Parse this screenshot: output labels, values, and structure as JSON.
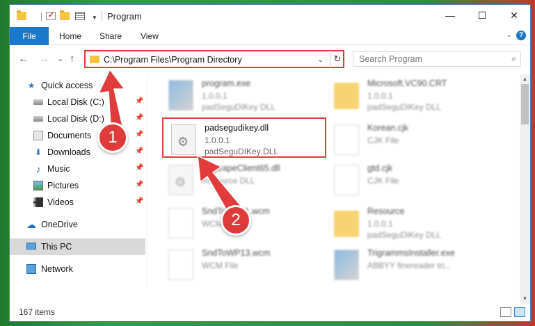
{
  "title_bar": {
    "title": "Program",
    "minimize_glyph": "—",
    "maximize_glyph": "☐",
    "close_glyph": "✕"
  },
  "ribbon": {
    "tabs": [
      "File",
      "Home",
      "Share",
      "View"
    ],
    "expand_glyph": "⌄",
    "help_glyph": "?"
  },
  "navigation": {
    "back_glyph": "←",
    "forward_glyph": "→",
    "recent_glyph": "⌄",
    "up_glyph": "↑"
  },
  "address_bar": {
    "path": "C:\\Program Files\\Program Directory",
    "dropdown_glyph": "⌄",
    "refresh_glyph": "↻"
  },
  "search": {
    "placeholder": "Search Program",
    "icon_glyph": "⌕"
  },
  "nav_pane": {
    "items": [
      {
        "label": "Quick access",
        "icon": "star-icon",
        "pinned": false
      },
      {
        "label": "Local Disk (C:)",
        "icon": "drive-icon",
        "pinned": true
      },
      {
        "label": "Local Disk (D:)",
        "icon": "drive-icon",
        "pinned": true
      },
      {
        "label": "Documents",
        "icon": "documents-icon",
        "pinned": true
      },
      {
        "label": "Downloads",
        "icon": "download-arrow-icon",
        "pinned": true
      },
      {
        "label": "Music",
        "icon": "music-note-icon",
        "pinned": true
      },
      {
        "label": "Pictures",
        "icon": "pictures-icon",
        "pinned": true
      },
      {
        "label": "Videos",
        "icon": "video-icon",
        "pinned": true
      },
      {
        "label": "OneDrive",
        "icon": "cloud-icon",
        "pinned": false
      },
      {
        "label": "This PC",
        "icon": "computer-icon",
        "pinned": false,
        "selected": true
      },
      {
        "label": "Network",
        "icon": "network-icon",
        "pinned": false
      }
    ],
    "pin_glyph": "📌",
    "star_glyph": "★",
    "download_glyph": "⬇",
    "music_glyph": "♪",
    "cloud_glyph": "☁"
  },
  "files": [
    {
      "name": "program.exe",
      "line2": "1.0.0.1",
      "line3": "padSeguDIKey DLL",
      "icon": "exe-icon",
      "blurred": true
    },
    {
      "name": "Microsoft.VC90.CRT",
      "line2": "1.0.0.1",
      "line3": "padSeguDIKey DLL",
      "icon": "folder-icon",
      "blurred": true
    },
    {
      "name": "padsegudikey.dll",
      "line2": "1.0.0.1",
      "line3": "padSeguDIKey DLL",
      "icon": "dll-gear-icon",
      "blurred": false
    },
    {
      "name": "Korean.cjk",
      "line2": "CJK File",
      "line3": "",
      "icon": "document-icon",
      "blurred": true
    },
    {
      "name": "BugtrapeClient65.dll",
      "line2": "Resource DLL",
      "line3": "",
      "icon": "dll-gear-icon",
      "blurred": true
    },
    {
      "name": "gtd.cjk",
      "line2": "CJK File",
      "line3": "",
      "icon": "document-icon",
      "blurred": true
    },
    {
      "name": "SndToWP11.wcm",
      "line2": "WCM File",
      "line3": "",
      "icon": "document-icon",
      "blurred": true
    },
    {
      "name": "Resource",
      "line2": "1.0.0.1",
      "line3": "padSeguDIKey DLL",
      "icon": "folder-icon",
      "blurred": true
    },
    {
      "name": "SndToWP13.wcm",
      "line2": "WCM File",
      "line3": "",
      "icon": "document-icon",
      "blurred": true
    },
    {
      "name": "TrigrammsInstaller.exe",
      "line2": "ABBYY finereader tri...",
      "line3": "",
      "icon": "exe-icon",
      "blurred": true
    }
  ],
  "status_bar": {
    "item_count": "167 items"
  },
  "annotations": {
    "step1": "1",
    "step2": "2",
    "color": "#e23b3b"
  },
  "scrollbar": {
    "up_glyph": "▲",
    "down_glyph": "▼"
  }
}
